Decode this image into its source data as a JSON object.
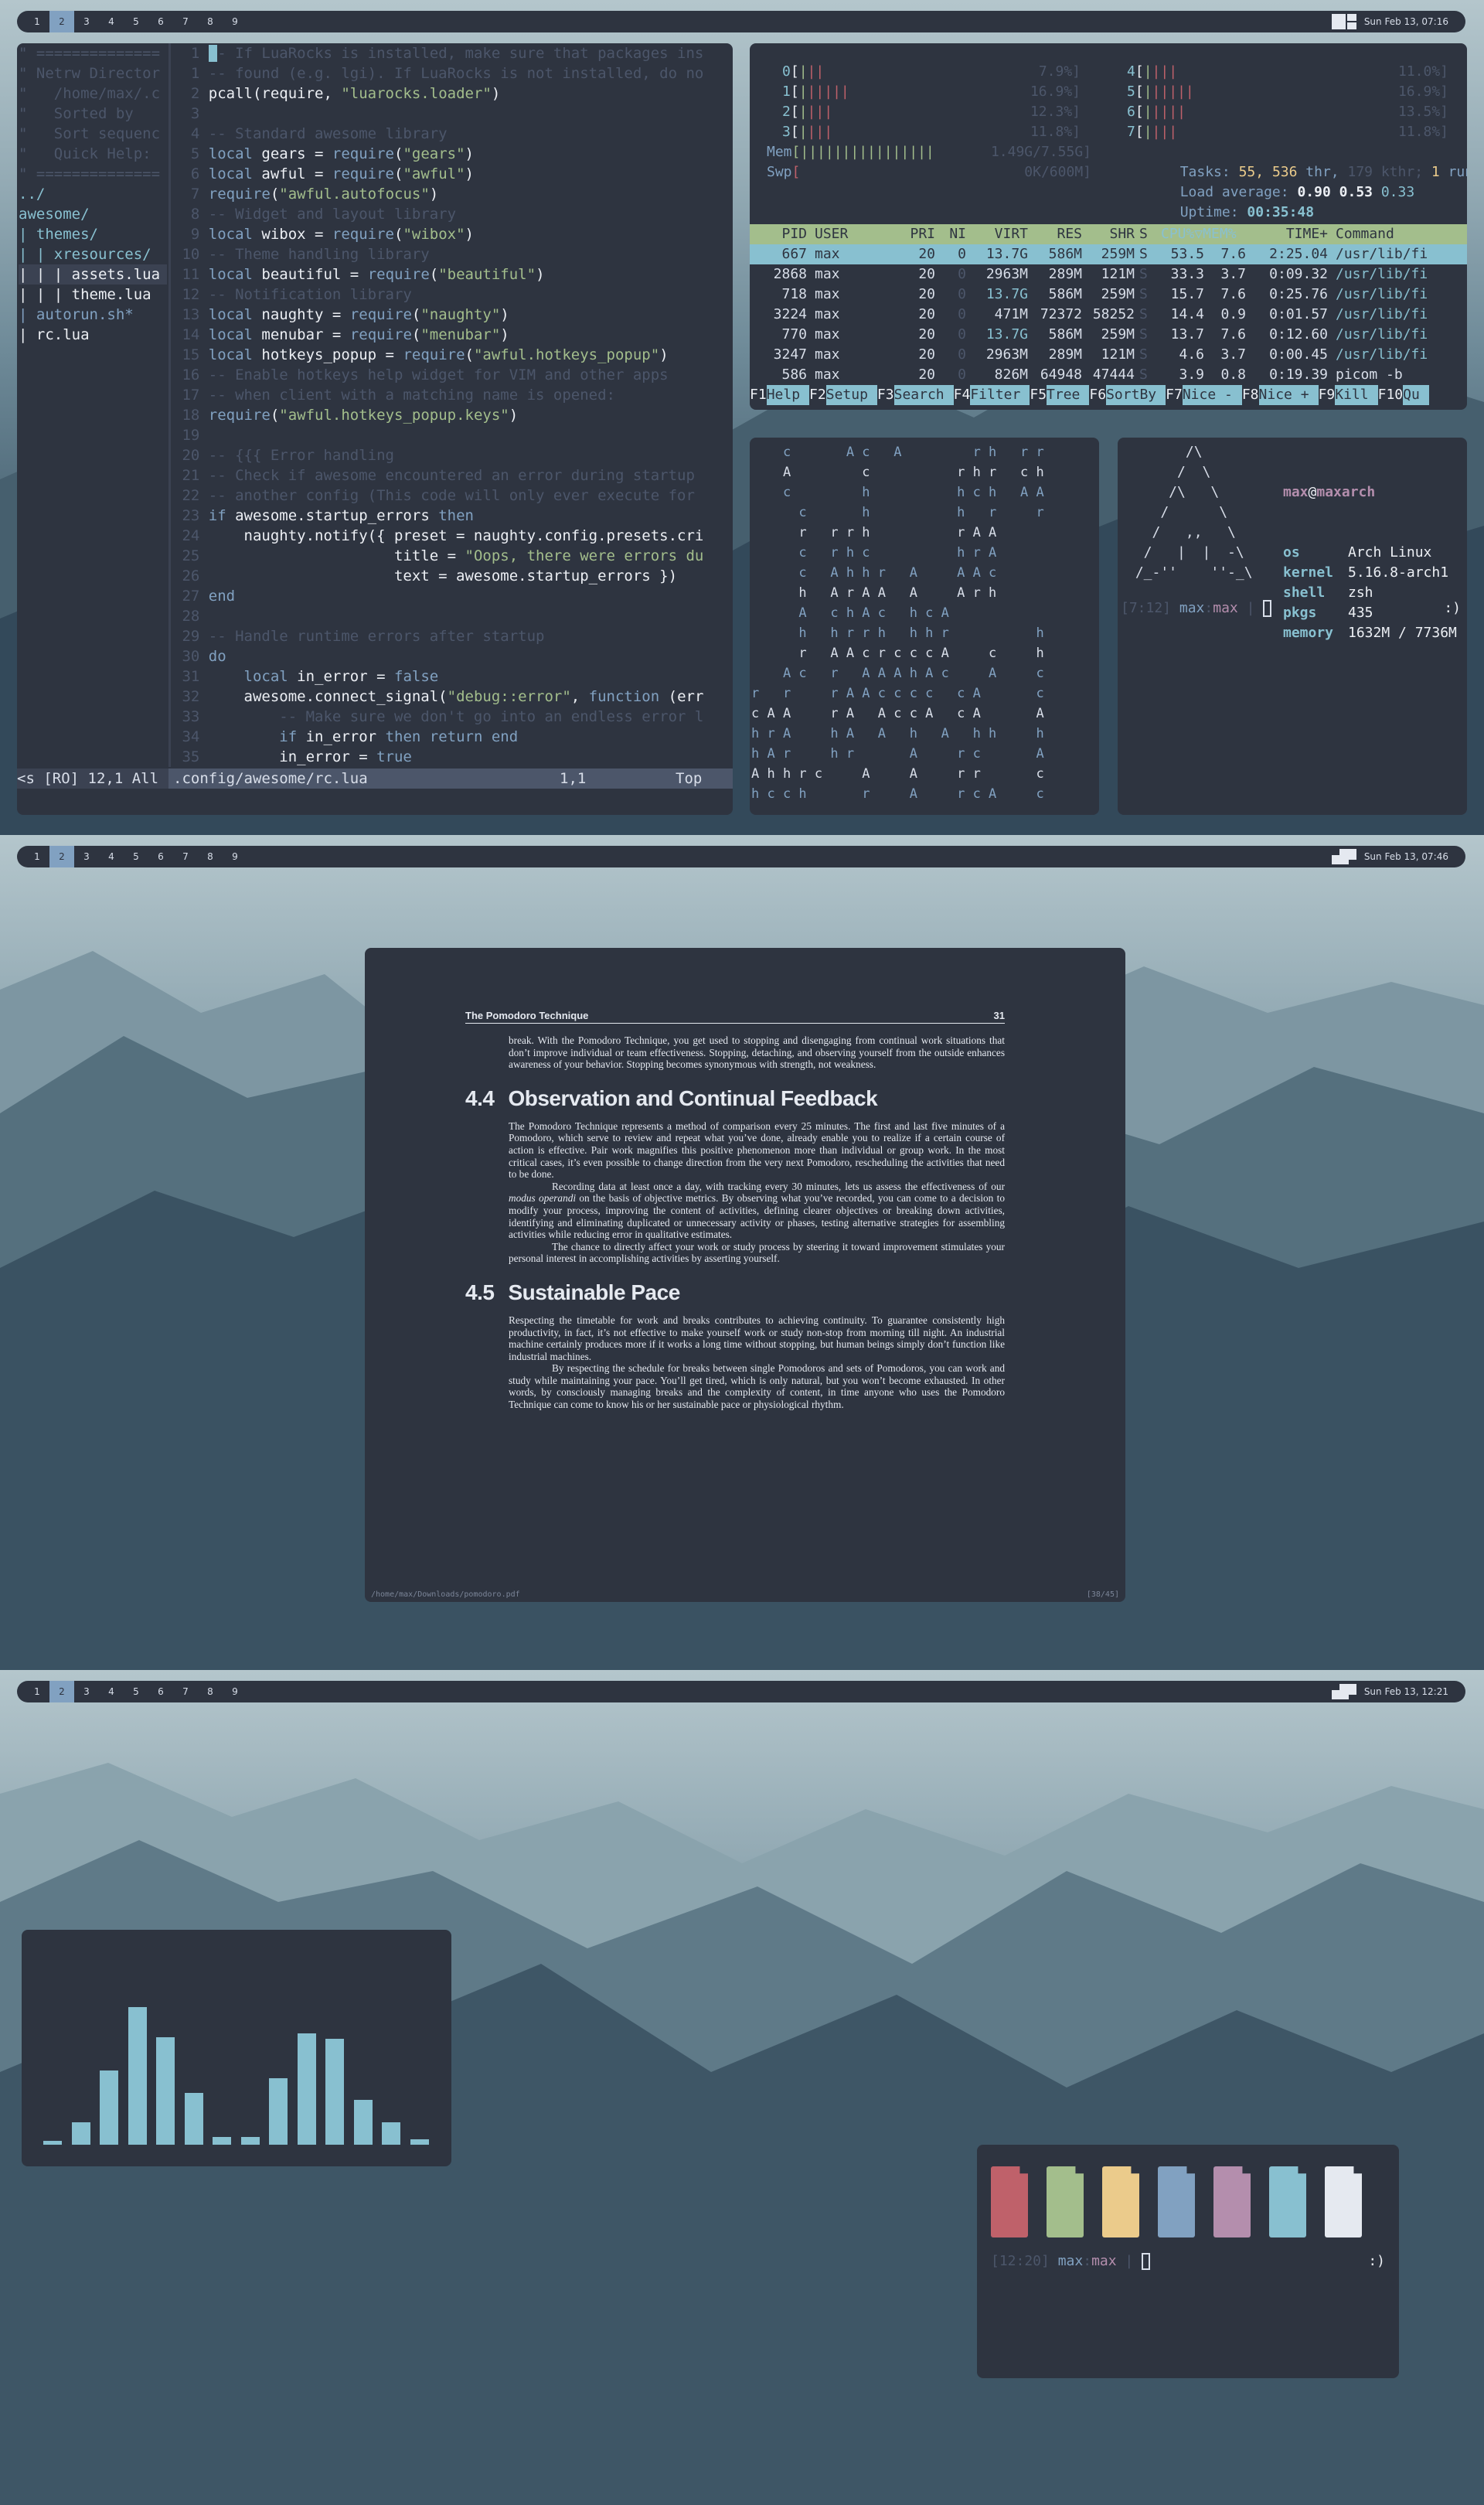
{
  "bar1": {
    "tags": [
      "1",
      "2",
      "3",
      "4",
      "5",
      "6",
      "7",
      "8",
      "9"
    ],
    "selected": "2",
    "clock": "Sun Feb 13, 07:16"
  },
  "bar2": {
    "tags": [
      "1",
      "2",
      "3",
      "4",
      "5",
      "6",
      "7",
      "8",
      "9"
    ],
    "selected": "2",
    "clock": "Sun Feb 13, 07:46"
  },
  "bar3": {
    "tags": [
      "1",
      "2",
      "3",
      "4",
      "5",
      "6",
      "7",
      "8",
      "9"
    ],
    "selected": "2",
    "clock": "Sun Feb 13, 12:21"
  },
  "netrw": {
    "lines": [
      "\" ==============",
      "\" Netrw Director",
      "\"   /home/max/.c",
      "\"   Sorted by",
      "\"   Sort sequenc",
      "\"   Quick Help:",
      "\" ==============",
      "../",
      "awesome/",
      "| themes/",
      "| | xresources/",
      "| | | assets.lua",
      "| | | theme.lua",
      "| autorun.sh*",
      "| rc.lua"
    ],
    "status": "<s [RO] 12,1 All"
  },
  "vim": {
    "status_file": ".config/awesome/rc.lua",
    "status_pos": "1,1",
    "status_top": "Top"
  },
  "htop": {
    "cpus": [
      {
        "n": "0",
        "bar": "[|||",
        "pct": "7.9%]"
      },
      {
        "n": "1",
        "bar": "[||||||",
        "pct": "16.9%]"
      },
      {
        "n": "2",
        "bar": "[||||",
        "pct": "12.3%]"
      },
      {
        "n": "3",
        "bar": "[||||",
        "pct": "11.8%]"
      },
      {
        "n": "4",
        "bar": "[||||",
        "pct": "11.0%]"
      },
      {
        "n": "5",
        "bar": "[||||||",
        "pct": "16.9%]"
      },
      {
        "n": "6",
        "bar": "[|||||",
        "pct": "13.5%]"
      },
      {
        "n": "7",
        "bar": "[||||",
        "pct": "11.8%]"
      }
    ],
    "mem": {
      "label": "Mem",
      "bar": "[||||||||||||||||",
      "val": "1.49G/7.55G]"
    },
    "swp": {
      "label": "Swp",
      "bar": "[",
      "val": "0K/600M]"
    },
    "tasks": {
      "label": "Tasks:",
      "procs": "55,",
      "thr_n": "536",
      "thr": "thr,",
      "kthr": "179 kthr;",
      "run_n": "1",
      "run": "runni"
    },
    "load": {
      "label": "Load average:",
      "a": "0.90",
      "b": "0.53",
      "c": "0.33"
    },
    "uptime": {
      "label": "Uptime:",
      "val": "00:35:48"
    },
    "header": [
      "PID",
      "USER",
      "PRI",
      "NI",
      "VIRT",
      "RES",
      "SHR",
      "S",
      "CPU%▽MEM%",
      "TIME+",
      "Command"
    ],
    "rows": [
      [
        "667",
        "max",
        "20",
        "0",
        "13.7G",
        "586M",
        "259M",
        "S",
        "53.5",
        "7.6",
        "2:25.04",
        "/usr/lib/fi"
      ],
      [
        "2868",
        "max",
        "20",
        "0",
        "2963M",
        "289M",
        "121M",
        "S",
        "33.3",
        "3.7",
        "0:09.32",
        "/usr/lib/fi"
      ],
      [
        "718",
        "max",
        "20",
        "0",
        "13.7G",
        "586M",
        "259M",
        "S",
        "15.7",
        "7.6",
        "0:25.76",
        "/usr/lib/fi"
      ],
      [
        "3224",
        "max",
        "20",
        "0",
        "471M",
        "72372",
        "58252",
        "S",
        "14.4",
        "0.9",
        "0:01.57",
        "/usr/lib/fi"
      ],
      [
        "770",
        "max",
        "20",
        "0",
        "13.7G",
        "586M",
        "259M",
        "S",
        "13.7",
        "7.6",
        "0:12.60",
        "/usr/lib/fi"
      ],
      [
        "3247",
        "max",
        "20",
        "0",
        "2963M",
        "289M",
        "121M",
        "S",
        "4.6",
        "3.7",
        "0:00.45",
        "/usr/lib/fi"
      ],
      [
        "586",
        "max",
        "20",
        "0",
        "826M",
        "64948",
        "47444",
        "S",
        "3.9",
        "0.8",
        "0:19.39",
        "picom -b"
      ]
    ],
    "fkeys": [
      [
        "F1",
        "Help"
      ],
      [
        "F2",
        "Setup"
      ],
      [
        "F3",
        "Search"
      ],
      [
        "F4",
        "Filter"
      ],
      [
        "F5",
        "Tree"
      ],
      [
        "F6",
        "SortBy"
      ],
      [
        "F7",
        "Nice -"
      ],
      [
        "F8",
        "Nice +"
      ],
      [
        "F9",
        "Kill"
      ],
      [
        "F10",
        "Qu"
      ]
    ]
  },
  "matrix": {
    "lines": [
      "    c       A c   A         r h   r r",
      "    A         c           r h r   c h",
      "    c         h           h c h   A A",
      "      c       h           h   r     r",
      "      r   r r h           r A A",
      "      c   r h c           h r A",
      "      c   A h h r   A     A A c",
      "      h   A r A A   A     A r h",
      "      A   c h A c   h c A",
      "      h   h r r h   h h r           h",
      "      r   A A c r c c c A     c     h",
      "    A c   r   A A A h A c     A     c",
      "r   r     r A A c c c c   c A       c",
      "c A A     r A   A c c A   c A       A",
      "h r A     h A   A   h   A   h h     h",
      "h A r     h r       A     r c       A",
      "A h h r c     A     A     r r       c",
      "h c c h       r     A     r c A     c"
    ]
  },
  "fetch": {
    "logo": [
      "       /\\",
      "      /  \\",
      "     /\\   \\",
      "    /      \\",
      "   /   ,,   \\",
      "  /   |  |  -\\",
      " /_-''    ''-_\\"
    ],
    "user": "max",
    "at": "@",
    "host": "maxarch",
    "info": [
      [
        "os",
        "Arch Linux"
      ],
      [
        "kernel",
        "5.16.8-arch1"
      ],
      [
        "shell",
        "zsh"
      ],
      [
        "pkgs",
        "435"
      ],
      [
        "memory",
        "1632M / 7736M"
      ]
    ]
  },
  "prompt1": {
    "time": "[7:12]",
    "user": "max",
    "colon": ":",
    "path": "max",
    "sep": "|",
    "smile": ":)"
  },
  "prompt3": {
    "time": "[12:20]",
    "user": "max",
    "colon": ":",
    "path": "max",
    "sep": "|",
    "smile": ":)"
  },
  "pdf": {
    "header_title": "The Pomodoro Technique",
    "page_no": "31",
    "intro": "break. With the Pomodoro Technique, you get used to stopping and disengaging from continual work situations that don’t improve individual or team effectiveness. Stopping, detaching, and observing yourself from the outside enhances awareness of your behavior. Stopping becomes synonymous with strength, not weakness.",
    "s1_num": "4.4",
    "s1_title": "Observation and Continual Feedback",
    "s1_p1": "The Pomodoro Technique represents a method of comparison every 25 minutes. The first and last five minutes of a Pomodoro, which serve to review and repeat what you’ve done, already enable you to realize if a certain course of action is effective. Pair work magnifies this positive phenomenon more than individual or group work. In the most critical cases, it’s even possible to change direction from the very next Pomodoro, rescheduling the activities that need to be done.",
    "s1_p2a": "Recording data at least once a day, with tracking every 30 minutes, lets us assess the effectiveness of our ",
    "s1_p2i": "modus operandi",
    "s1_p2b": " on the basis of objective metrics. By observing what you’ve recorded, you can come to a decision to modify your process, improving the content of activities, defining clearer objectives or breaking down activities, identifying and eliminating duplicated or unnecessary activity or phases, testing alternative strategies for assembling activities while reducing error in qualitative estimates.",
    "s1_p3": "The chance to directly affect your work or study process by steering it toward improvement stimulates your personal interest in accomplishing activities by asserting yourself.",
    "s2_num": "4.5",
    "s2_title": "Sustainable Pace",
    "s2_p1": "Respecting the timetable for work and breaks contributes to achieving continuity. To guarantee consistently high productivity, in fact, it’s not effective to make yourself work or study non-stop from morning till night. An industrial machine certainly produces more if it works a long time without stopping, but human beings simply don’t function like industrial machines.",
    "s2_p2": "By respecting the schedule for breaks between single Pomodoros and sets of Pomodoros, you can work and study while maintaining your pace. You’ll get tired, which is only natural, but you won’t become exhausted. In other words, by consciously managing breaks and the complexity of content, in time anyone who uses the Pomodoro Technique can come to know his or her sustainable pace or physiological rhythm.",
    "footer_path": "/home/max/Downloads/pomodoro.pdf",
    "footer_pages": "[38/45]"
  },
  "visualizer": {
    "levels": [
      0.02,
      0.12,
      0.4,
      0.74,
      0.58,
      0.28,
      0.04,
      0.04,
      0.36,
      0.6,
      0.57,
      0.24,
      0.12,
      0.03
    ]
  },
  "colors": {
    "bg": "#2e3440",
    "accent": "#88c0d0",
    "swatches": [
      "#bf616a",
      "#a3be8c",
      "#ebcb8b",
      "#81a1c1",
      "#b48ead",
      "#88c0d0",
      "#e5e9f0"
    ]
  }
}
